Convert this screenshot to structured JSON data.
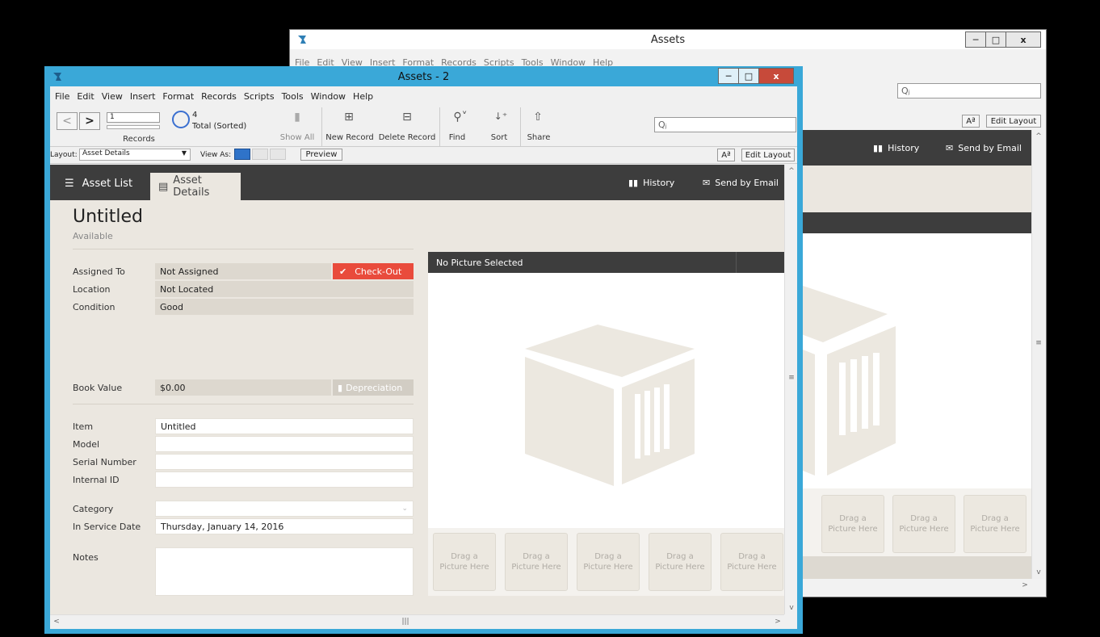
{
  "back_window": {
    "title": "Assets",
    "menu": [
      "File",
      "Edit",
      "View",
      "Insert",
      "Format",
      "Records",
      "Scripts",
      "Tools",
      "Window",
      "Help"
    ],
    "search_placeholder": "Qⱼ",
    "font_btn": "Aª",
    "edit_layout": "Edit Layout",
    "history": "History",
    "send_email": "Send by Email",
    "drops": [
      "Drag a\nPicture Here",
      "Drag a\nPicture Here",
      "Drag a\nPicture Here"
    ]
  },
  "front_window": {
    "title": "Assets - 2",
    "menu": [
      "File",
      "Edit",
      "View",
      "Insert",
      "Format",
      "Records",
      "Scripts",
      "Tools",
      "Window",
      "Help"
    ],
    "toolbar": {
      "record_number": "1",
      "records_label": "Records",
      "total_count": "4",
      "total_label": "Total (Sorted)",
      "show_all": "Show All",
      "new_record": "New Record",
      "delete_record": "Delete Record",
      "find": "Find",
      "sort": "Sort",
      "share": "Share",
      "search_placeholder": "Qⱼ"
    },
    "layout_bar": {
      "layout_label": "Layout:",
      "layout_value": "Asset Details",
      "view_as": "View As:",
      "preview": "Preview",
      "font_btn": "Aª",
      "edit_layout": "Edit Layout"
    },
    "nav": {
      "asset_list": "Asset List",
      "asset_details": "Asset Details",
      "history": "History",
      "send_email": "Send by Email"
    },
    "record": {
      "title": "Untitled",
      "status": "Available",
      "assigned_to_label": "Assigned To",
      "assigned_to": "Not Assigned",
      "checkout": "Check-Out",
      "location_label": "Location",
      "location": "Not Located",
      "condition_label": "Condition",
      "condition": "Good",
      "book_value_label": "Book Value",
      "book_value": "$0.00",
      "depreciation": "Depreciation",
      "item_label": "Item",
      "item": "Untitled",
      "model_label": "Model",
      "serial_label": "Serial Number",
      "internal_id_label": "Internal ID",
      "category_label": "Category",
      "in_service_label": "In Service Date",
      "in_service": "Thursday, January 14, 2016",
      "notes_label": "Notes"
    },
    "picture": {
      "header": "No Picture Selected",
      "drops": [
        "Drag a\nPicture Here",
        "Drag a\nPicture Here",
        "Drag a\nPicture Here",
        "Drag a\nPicture Here",
        "Drag a\nPicture Here"
      ]
    }
  },
  "colors": {
    "accent_frame": "#3aa8d8",
    "checkout_red": "#e94b3c",
    "dark_header": "#3d3d3d",
    "body_beige": "#ebe7e0"
  }
}
